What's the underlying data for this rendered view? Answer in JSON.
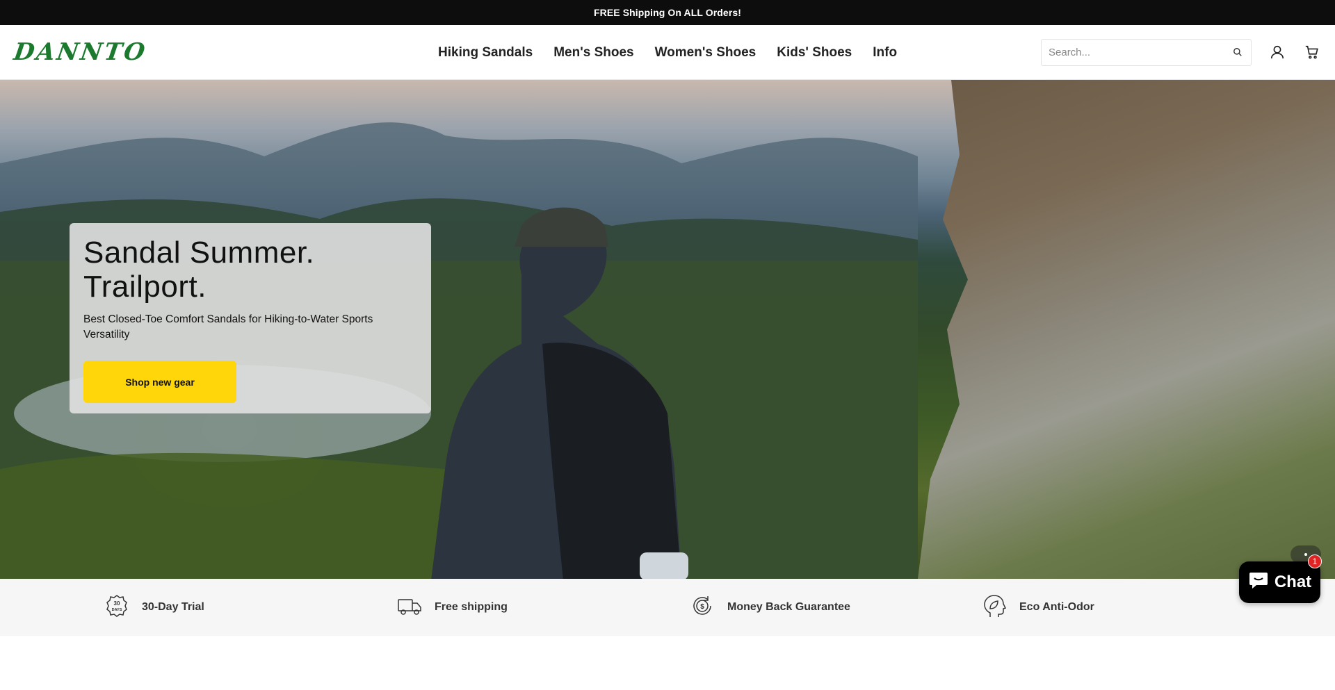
{
  "announcement": {
    "text": "FREE Shipping On ALL Orders!"
  },
  "header": {
    "logo": "DANNTO",
    "nav": [
      {
        "label": "Hiking Sandals"
      },
      {
        "label": "Men's Shoes"
      },
      {
        "label": "Women's Shoes"
      },
      {
        "label": "Kids' Shoes"
      },
      {
        "label": "Info"
      }
    ],
    "search": {
      "placeholder": "Search..."
    },
    "icons": [
      "search-icon",
      "account-icon",
      "cart-icon"
    ]
  },
  "hero": {
    "title_line1": "Sandal Summer.",
    "title_line2": "Trailport.",
    "subtitle": "Best Closed-Toe Comfort Sandals for Hiking-to-Water Sports Versatility",
    "cta": "Shop new gear",
    "cta_color": "#ffd60a"
  },
  "features": [
    {
      "icon": "30-days-icon",
      "label": "30-Day Trial"
    },
    {
      "icon": "truck-icon",
      "label": "Free shipping"
    },
    {
      "icon": "money-back-icon",
      "label": "Money Back Guarantee"
    },
    {
      "icon": "leaf-head-icon",
      "label": "Eco Anti-Odor"
    }
  ],
  "chat": {
    "label": "Chat",
    "badge": "1"
  },
  "colors": {
    "brand": "#1c7a2e",
    "announcement_bg": "#0d0d0d",
    "cta": "#ffd60a",
    "badge": "#e02424"
  }
}
